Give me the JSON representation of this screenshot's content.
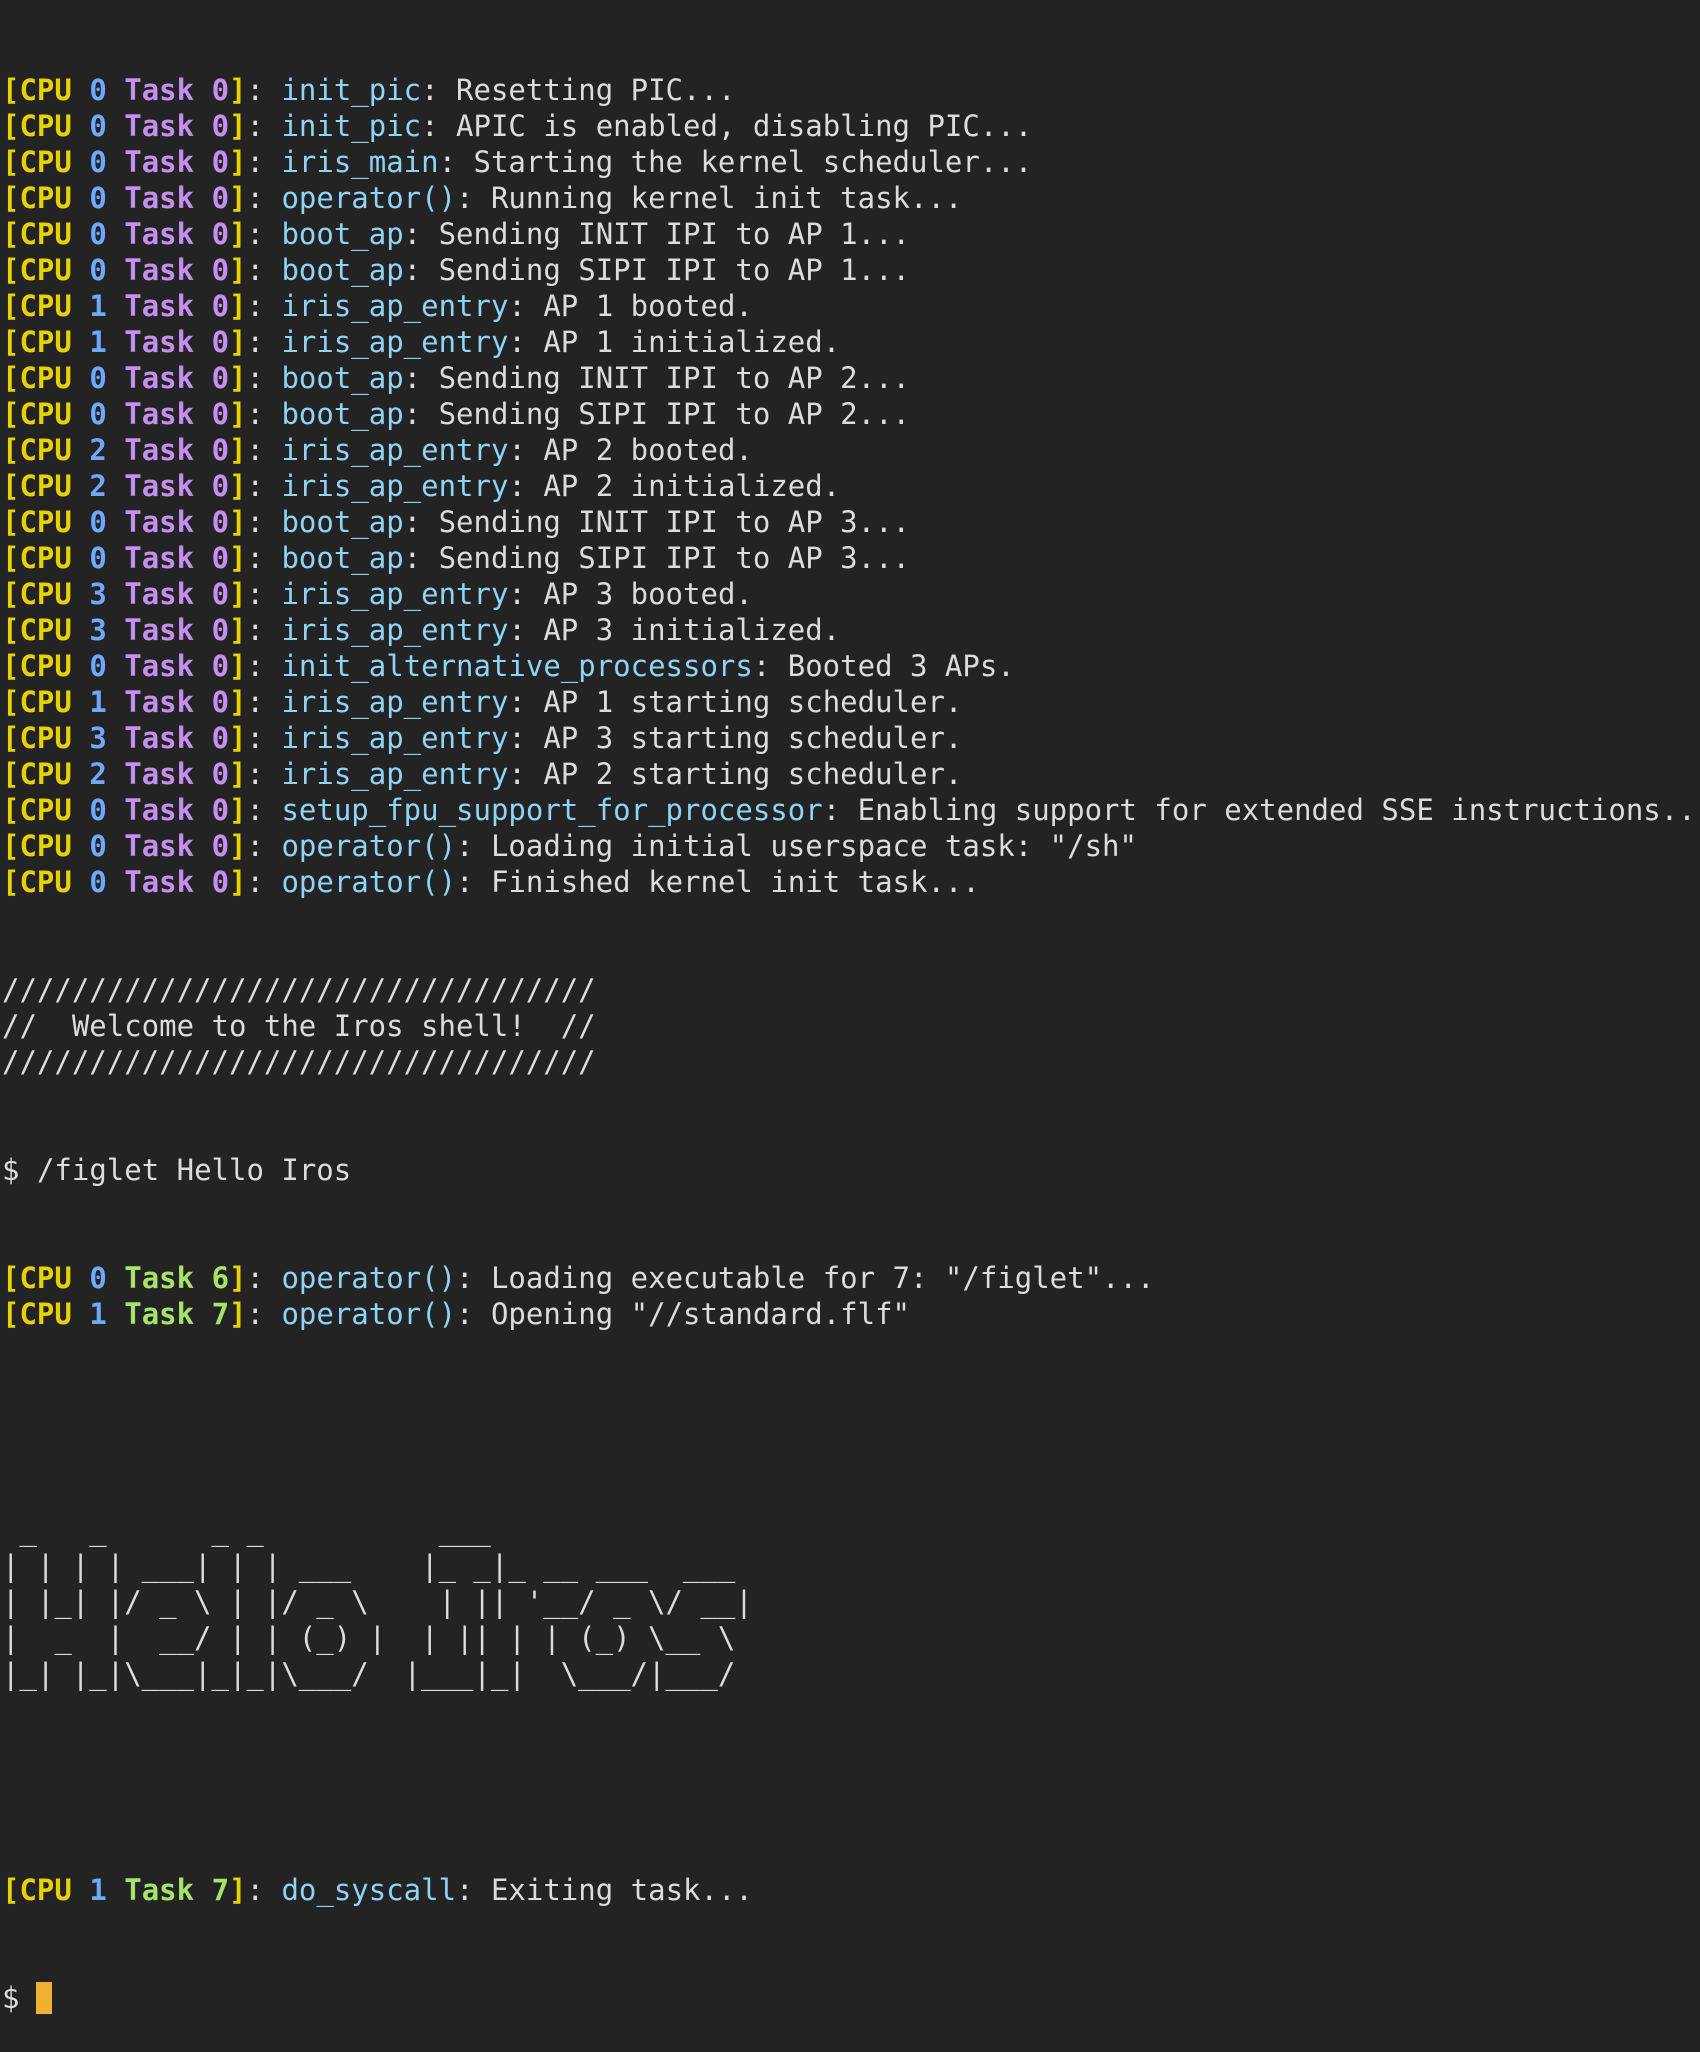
{
  "colors": {
    "background": "#232323",
    "text": "#dcdcdc",
    "bracket": "#e6d200",
    "cpu_label": "#e6d200",
    "cpu_number": "#6fa8ff",
    "task_kernel": "#c58ff0",
    "task_user": "#a6e36a",
    "function_name": "#8fd3f5",
    "cursor": "#f0b030"
  },
  "log_lines": [
    {
      "cpu": "0",
      "task": "0",
      "fn": "init_pic",
      "msg": "Resetting PIC..."
    },
    {
      "cpu": "0",
      "task": "0",
      "fn": "init_pic",
      "msg": "APIC is enabled, disabling PIC..."
    },
    {
      "cpu": "0",
      "task": "0",
      "fn": "iris_main",
      "msg": "Starting the kernel scheduler..."
    },
    {
      "cpu": "0",
      "task": "0",
      "fn": "operator()",
      "msg": "Running kernel init task..."
    },
    {
      "cpu": "0",
      "task": "0",
      "fn": "boot_ap",
      "msg": "Sending INIT IPI to AP 1..."
    },
    {
      "cpu": "0",
      "task": "0",
      "fn": "boot_ap",
      "msg": "Sending SIPI IPI to AP 1..."
    },
    {
      "cpu": "1",
      "task": "0",
      "fn": "iris_ap_entry",
      "msg": "AP 1 booted."
    },
    {
      "cpu": "1",
      "task": "0",
      "fn": "iris_ap_entry",
      "msg": "AP 1 initialized."
    },
    {
      "cpu": "0",
      "task": "0",
      "fn": "boot_ap",
      "msg": "Sending INIT IPI to AP 2..."
    },
    {
      "cpu": "0",
      "task": "0",
      "fn": "boot_ap",
      "msg": "Sending SIPI IPI to AP 2..."
    },
    {
      "cpu": "2",
      "task": "0",
      "fn": "iris_ap_entry",
      "msg": "AP 2 booted."
    },
    {
      "cpu": "2",
      "task": "0",
      "fn": "iris_ap_entry",
      "msg": "AP 2 initialized."
    },
    {
      "cpu": "0",
      "task": "0",
      "fn": "boot_ap",
      "msg": "Sending INIT IPI to AP 3..."
    },
    {
      "cpu": "0",
      "task": "0",
      "fn": "boot_ap",
      "msg": "Sending SIPI IPI to AP 3..."
    },
    {
      "cpu": "3",
      "task": "0",
      "fn": "iris_ap_entry",
      "msg": "AP 3 booted."
    },
    {
      "cpu": "3",
      "task": "0",
      "fn": "iris_ap_entry",
      "msg": "AP 3 initialized."
    },
    {
      "cpu": "0",
      "task": "0",
      "fn": "init_alternative_processors",
      "msg": "Booted 3 APs."
    },
    {
      "cpu": "1",
      "task": "0",
      "fn": "iris_ap_entry",
      "msg": "AP 1 starting scheduler."
    },
    {
      "cpu": "3",
      "task": "0",
      "fn": "iris_ap_entry",
      "msg": "AP 3 starting scheduler."
    },
    {
      "cpu": "2",
      "task": "0",
      "fn": "iris_ap_entry",
      "msg": "AP 2 starting scheduler."
    },
    {
      "cpu": "0",
      "task": "0",
      "fn": "setup_fpu_support_for_processor",
      "msg": "Enabling support for extended SSE instructions..."
    },
    {
      "cpu": "0",
      "task": "0",
      "fn": "operator()",
      "msg": "Loading initial userspace task: \"/sh\""
    },
    {
      "cpu": "0",
      "task": "0",
      "fn": "operator()",
      "msg": "Finished kernel init task..."
    }
  ],
  "banner": [
    "//////////////////////////////////",
    "//  Welcome to the Iros shell!  //",
    "//////////////////////////////////"
  ],
  "command": {
    "prompt": "$",
    "text": "/figlet Hello Iros"
  },
  "task_lines": [
    {
      "cpu": "0",
      "task": "6",
      "fn": "operator()",
      "msg": "Loading executable for 7: \"/figlet\"..."
    },
    {
      "cpu": "1",
      "task": "7",
      "fn": "operator()",
      "msg": "Opening \"//standard.flf\""
    }
  ],
  "figlet": [
    " _   _      _ _          ___",
    "| | | | ___| | | ___    |_ _|_ __ ___  ___",
    "| |_| |/ _ \\ | |/ _ \\    | || '__/ _ \\/ __|",
    "|  _  |  __/ | | (_) |  | || | | (_) \\__ \\",
    "|_| |_|\\___|_|_|\\___/  |___|_|  \\___/|___/"
  ],
  "exit_line": {
    "cpu": "1",
    "task": "7",
    "fn": "do_syscall",
    "msg": "Exiting task..."
  },
  "final_prompt": "$",
  "labels": {
    "cpu": "CPU",
    "task": "Task",
    "open_bracket": "[",
    "close_bracket": "]",
    "separator": ": "
  }
}
